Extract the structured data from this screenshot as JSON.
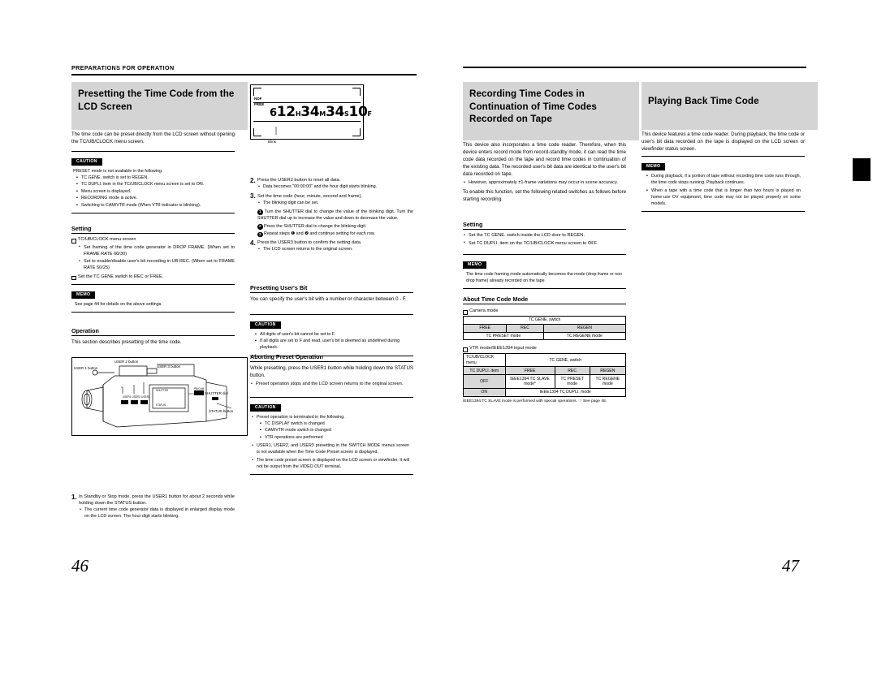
{
  "left_page": {
    "running_head": "PREPARATIONS FOR OPERATION",
    "page_number": "46",
    "title": "Presetting the Time Code from the LCD Screen",
    "intro": "The time code can be preset directly from the LCD screen without opening the TC/UB/CLOCK menu screen.",
    "caution1": {
      "tab": "CAUTION",
      "lead": "PRESET mode is not available in the following.",
      "items": [
        "TC GENE. switch is set to REGEN.",
        "TC DUPLI. item in the TC/UB/CLOCK menu screen is set to ON.",
        "Menu screen is displayed.",
        "RECORDING mode is active.",
        "Switching to CAM/VTR mode (When VTR indicator is blinking)."
      ]
    },
    "setting_heading": "Setting",
    "setting_items": [
      "TC/UB/CLOCK menu screen",
      "Set framing of the time code generator in DROP FRAME. (When set to FRAME RATE 60/30)",
      "Set to enable/disable user's bit recording in UB REC. (When set to FRAME RATE 50/25)",
      "Set the TC GENE switch to REC or FREE."
    ],
    "memo1": {
      "tab": "MEMO",
      "text": "See page 44 for details on the above settings."
    },
    "operation_heading": "Operation",
    "operation_text": "This section describes presetting of the time code.",
    "lcd": {
      "line1_label": "NDF",
      "line2_label": "FREE",
      "digits_prefix": "6",
      "hour": "12",
      "hour_unit": "H",
      "minute": "34",
      "minute_unit": "M",
      "second": "34",
      "second_unit": "S",
      "frame": "10",
      "frame_unit": "F",
      "blink_label": "Blink"
    },
    "camera": {
      "user1": "USER 1 button",
      "user2": "USER 2 button",
      "user3": "USER 3 button",
      "shutter": "SHUTTER dial",
      "status": "STATUS button"
    },
    "steps": [
      {
        "n": "1.",
        "text": "In Standby or Stop mode, press the USER1 button for about 2 seconds while holding down the STATUS button.",
        "sub": [
          "The current time code generator data is displayed in enlarged display mode on the LCD screen. The hour digit starts blinking."
        ]
      }
    ]
  },
  "mid_column": {
    "steps": [
      {
        "n": "2.",
        "text": "Press the USER2 button to reset all data.",
        "sub": [
          "Data becomes \"00:00:00\" and the hour digit starts blinking."
        ]
      },
      {
        "n": "3.",
        "text": "Set the time code (hour, minute, second and frame).",
        "sub": [
          "The blinking digit can be set."
        ]
      }
    ],
    "step3_circles": [
      "Turn the SHUTTER dial to change the value of the blinking digit. Turn the SHUTTER dial up to increase the value and down to decrease the value.",
      "Press the SHUTTER dial to change the blinking digit.",
      "Repeat steps ❶ and ❷ and continue setting for each row."
    ],
    "step4": {
      "n": "4.",
      "text": "Press the USER3 button to confirm the setting data.",
      "sub": [
        "The LCD screen returns to the original screen."
      ]
    },
    "users_bit_heading": "Presetting User's Bit",
    "users_bit_text": "You can specify the user's bit with a number or character between 0 - F.",
    "caution2": {
      "tab": "CAUTION",
      "lines": [
        "All digits of user's bit cannot be set to F.",
        "If all digits are set to F and read, user's bit is deemed as undefined during playback."
      ]
    },
    "aborting_heading": "Aborting Preset Operation",
    "aborting_text": "While presetting, press the USER1 button while holding down the STATUS button.",
    "aborting_sub": [
      "Preset operation stops and the LCD screen returns to the original screen."
    ],
    "caution3": {
      "tab": "CAUTION",
      "lead": "Preset operation is terminated in the following.",
      "items": [
        "TC DISPLAY switch is changed",
        "CAM/VTR mode switch is changed",
        "VTR operations are performed"
      ],
      "extra": [
        "USER1, USER2, and USER3 presetting in the SWITCH MODE menus screen is not available when the Time Code Preset screen is displayed.",
        "The time code preset screen is displayed on the LCD screen or viewfinder. It will not be output from the VIDEO OUT terminal."
      ]
    }
  },
  "right_page": {
    "page_number": "47",
    "title_a": "Recording Time Codes in Continuation of Time Codes Recorded on Tape",
    "intro_a": "This device also incorporates a time code reader. Therefore, when this device enters record mode from record-standby mode, it can read the time code data recorded on the tape and record time codes in continuation of the existing data. The recorded user's bit data are identical to the user's bit data recorded on tape.",
    "intro_a_bullets": [
      "However, approximately ±1-frame variations may occur in scene accuracy."
    ],
    "intro_a_tail": "To enable this function, set the following related switches as follows before starting recording.",
    "setting_heading": "Setting",
    "setting_items": [
      "Set the TC GENE. switch inside the LCD door to REGEN.",
      "Set TC DUPLI. item on the TC/UB/CLOCK menu screen to OFF."
    ],
    "memo_a": {
      "tab": "MEMO",
      "text": "The time code framing mode automatically becomes the mode (drop frame or non drop frame) already recorded on the tape."
    },
    "about_heading": "About Time Code Mode",
    "table1_caption": "Camera mode",
    "table1": {
      "header_span": "TC GENE. switch",
      "cols": [
        "FREE",
        "REC",
        "REGEN"
      ],
      "rows": [
        [
          "TC PRESET mode",
          "TC REGENE mode"
        ]
      ]
    },
    "table2_caption": "VTR mode/IEEE1394 input mode",
    "table2": {
      "corner": "TC/UB/CLOCK menu",
      "header_span": "TC GENE. switch",
      "cols": [
        "FREE",
        "REC",
        "REGEN"
      ],
      "row_label_header": "TC DUPLI. item",
      "rows": [
        {
          "label": "OFF",
          "cells": [
            "IEEE1394 TC SLAVE mode*",
            "TC PRESET mode",
            "TC REGENE mode"
          ]
        },
        {
          "label": "ON",
          "cells": [
            "IEEE1394 TC DUPLI. mode"
          ]
        }
      ]
    },
    "table_note": "IEEE1394 TC SLAVE mode is performed with special operations. ☞ See page 48.",
    "title_b": "Playing Back Time Code",
    "intro_b": "This device features a time code reader. During playback, the time code or user's bit data recorded on the tape is displayed on the LCD screen or viewfinder status screen.",
    "memo_b": {
      "tab": "MEMO",
      "items": [
        "During playback, if a portion of tape without recording time code runs through, the time code stops running. Playback continues.",
        "When a tape with a time code that is longer than two hours is played on home-use DV equipment, time code may not be played properly on some models."
      ]
    }
  }
}
